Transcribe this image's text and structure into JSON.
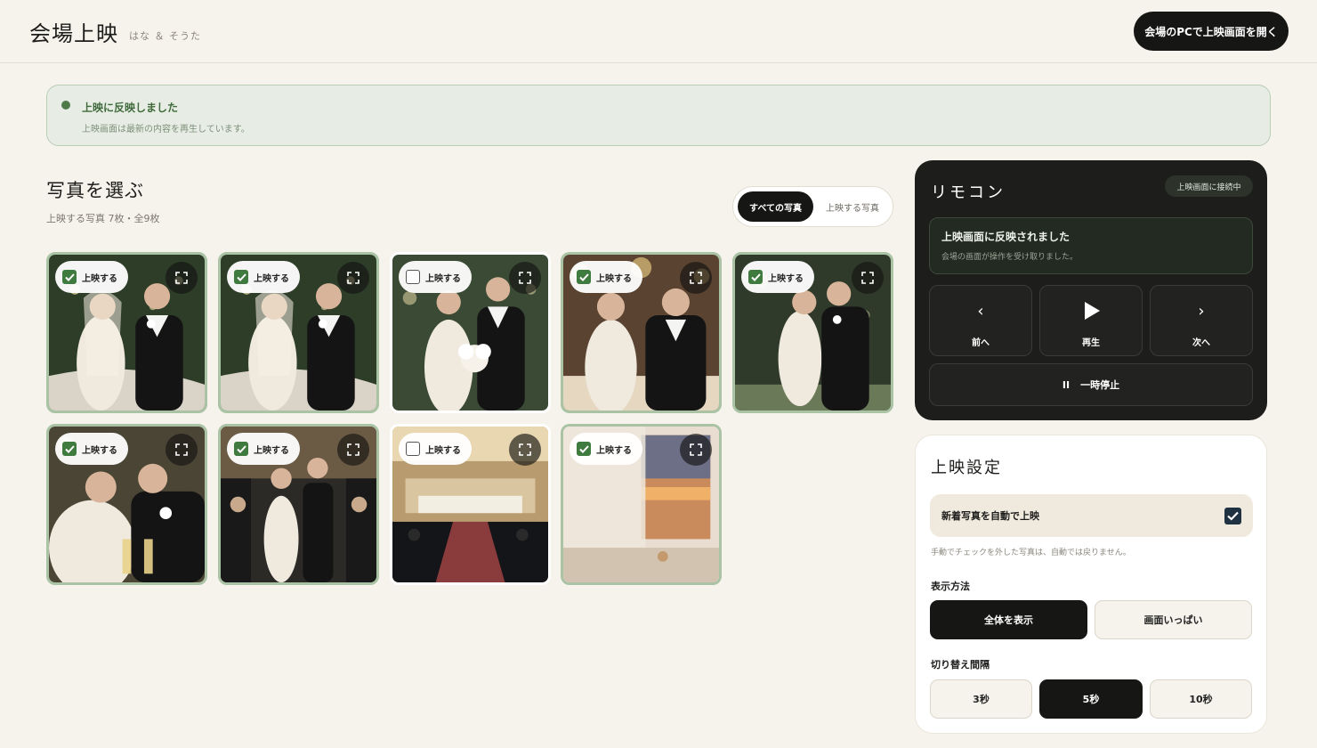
{
  "header": {
    "title": "会場上映",
    "subtitle": "はな ＆ そうた",
    "open_button": "会場のPCで上映画面を開く"
  },
  "banner": {
    "title": "上映に反映しました",
    "text": "上映画面は最新の内容を再生しています。"
  },
  "photos_section": {
    "title": "写真を選ぶ",
    "summary": "上映する写真 7枚・全9枚",
    "filter_all": "すべての写真",
    "filter_selected": "上映する写真",
    "photo_checkbox_label": "上映する",
    "photos": [
      {
        "scene": "garden-couple",
        "selected": true
      },
      {
        "scene": "garden-couple",
        "selected": true
      },
      {
        "scene": "bouquet-couple",
        "selected": false
      },
      {
        "scene": "candle-couple",
        "selected": true
      },
      {
        "scene": "garden-dusk",
        "selected": true
      },
      {
        "scene": "toast",
        "selected": true
      },
      {
        "scene": "aisle",
        "selected": true
      },
      {
        "scene": "venue-hall",
        "selected": false
      },
      {
        "scene": "window-sunset",
        "selected": true
      }
    ]
  },
  "remote": {
    "title": "リモコン",
    "badge": "上映画面に接続中",
    "status_title": "上映画面に反映されました",
    "status_text": "会場の画面が操作を受け取りました。",
    "prev_label": "前へ",
    "play_label": "再生",
    "next_label": "次へ",
    "pause_label": "一時停止",
    "prev_symbol": "‹",
    "next_symbol": "›",
    "pause_symbol": "II"
  },
  "settings": {
    "title": "上映設定",
    "auto_label": "新着写真を自動で上映",
    "auto_checked": true,
    "auto_note": "手動でチェックを外した写真は、自動では戻りません。",
    "display_label": "表示方法",
    "display_options": [
      "全体を表示",
      "画面いっぱい"
    ],
    "display_selected": "全体を表示",
    "interval_label": "切り替え間隔",
    "interval_options": [
      "3秒",
      "5秒",
      "10秒"
    ],
    "interval_selected": "5秒"
  }
}
